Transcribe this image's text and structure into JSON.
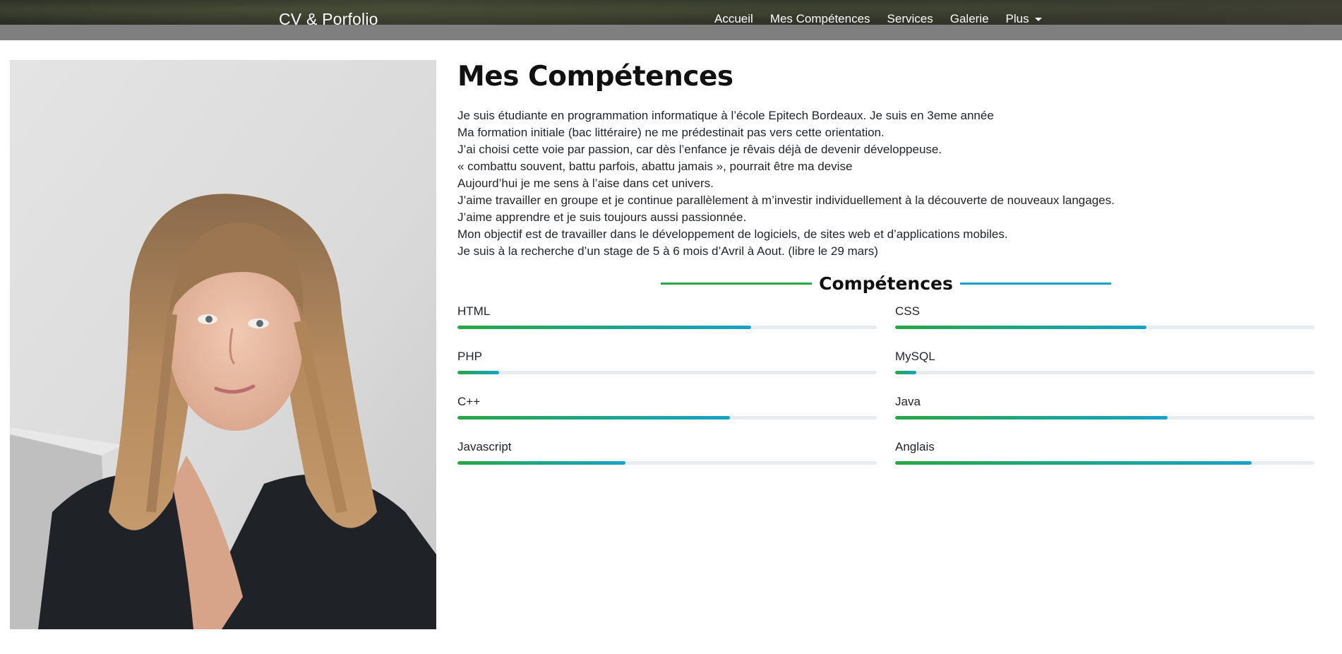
{
  "navbar": {
    "brand": "CV & Porfolio",
    "links": [
      {
        "label": "Accueil"
      },
      {
        "label": "Mes Compétences"
      },
      {
        "label": "Services"
      },
      {
        "label": "Galerie"
      },
      {
        "label": "Plus"
      }
    ]
  },
  "main": {
    "title": "Mes Compétences",
    "intro": [
      "Je suis étudiante en programmation informatique à l’école Epitech Bordeaux. Je suis en 3eme année",
      "Ma formation initiale (bac littéraire) ne me prédestinait pas vers cette orientation.",
      "J’ai choisi cette voie par passion, car dès l’enfance je rêvais déjà de devenir développeuse.",
      "« combattu souvent, battu parfois, abattu jamais », pourrait être ma devise",
      "Aujourd’hui je me sens à l’aise dans cet univers.",
      "J’aime travailler en groupe et je continue parallèlement à m’investir individuellement à la découverte de nouveaux langages.",
      "J’aime apprendre et je suis toujours aussi passionnée.",
      "Mon objectif est de travailler dans le développement de logiciels, de sites web et d’applications mobiles.",
      "Je suis à la recherche d’un stage de 5 à 6 mois d’Avril à Aout. (libre le 29 mars)"
    ],
    "skills_title": "Compétences",
    "skills": [
      {
        "name": "HTML",
        "level": 70
      },
      {
        "name": "CSS",
        "level": 60
      },
      {
        "name": "PHP",
        "level": 10
      },
      {
        "name": "MySQL",
        "level": 5
      },
      {
        "name": "C++",
        "level": 65
      },
      {
        "name": "Java",
        "level": 65
      },
      {
        "name": "Javascript",
        "level": 40
      },
      {
        "name": "Anglais",
        "level": 85
      }
    ]
  },
  "colors": {
    "bar_start": "#28a745",
    "bar_end": "#17a2c8",
    "bar_track": "#e9ecef",
    "nav_strip": "#7f7f7f"
  }
}
